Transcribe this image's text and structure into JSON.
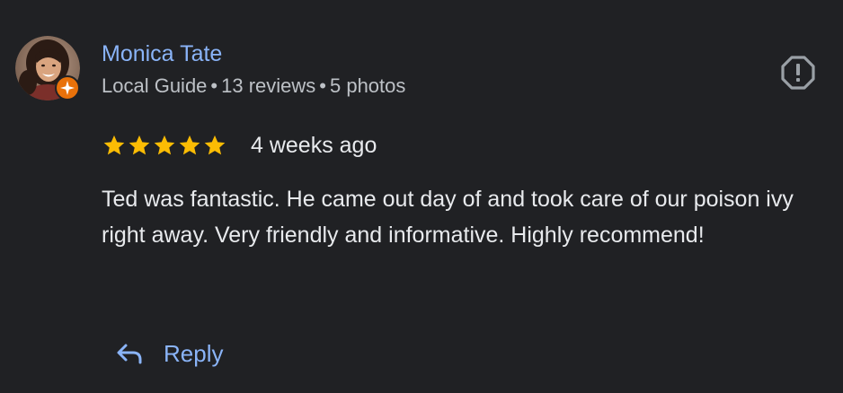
{
  "review": {
    "reviewer_name": "Monica Tate",
    "reviewer_badge": "Local Guide",
    "separator": "•",
    "reviews_count": "13 reviews",
    "photos_count": "5 photos",
    "rating": 5,
    "rating_max": 5,
    "relative_time": "4 weeks ago",
    "text": "Ted was fantastic. He came out day of and took care of our poison ivy right away. Very friendly and informative. Highly recommend!",
    "reply_label": "Reply"
  },
  "icons": {
    "report": "flag-report-icon",
    "reply": "reply-arrow-icon",
    "badge": "local-guide-badge-icon",
    "star": "star-icon"
  },
  "colors": {
    "background": "#202124",
    "link": "#8ab4f8",
    "text_primary": "#e8eaed",
    "text_secondary": "#bdc1c6",
    "star": "#fbbc04",
    "badge": "#e8710a",
    "icon_gray": "#9aa0a6"
  }
}
